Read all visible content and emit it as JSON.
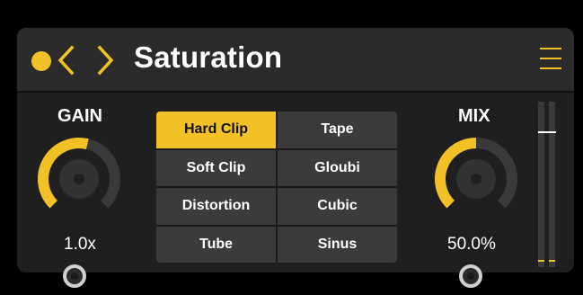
{
  "header": {
    "title": "Saturation",
    "icons": [
      "power-icon",
      "chevron-left-icon",
      "chevron-right-icon",
      "hamburger-menu-icon"
    ]
  },
  "gain": {
    "label": "GAIN",
    "value_text": "1.0x",
    "knob_level": 0.55
  },
  "mix": {
    "label": "MIX",
    "value_text": "50.0%",
    "knob_level": 0.5
  },
  "algorithms": {
    "items": [
      "Hard Clip",
      "Tape",
      "Soft Clip",
      "Gloubi",
      "Distortion",
      "Cubic",
      "Tube",
      "Sinus"
    ],
    "selected": "Hard Clip"
  },
  "meter": {
    "peak_level": 0.82,
    "levels": [
      0.0,
      0.0
    ]
  },
  "colors": {
    "accent": "#f2c126",
    "panel": "#1f1f1f",
    "header": "#2b2b2b",
    "button": "#3b3b3b"
  }
}
